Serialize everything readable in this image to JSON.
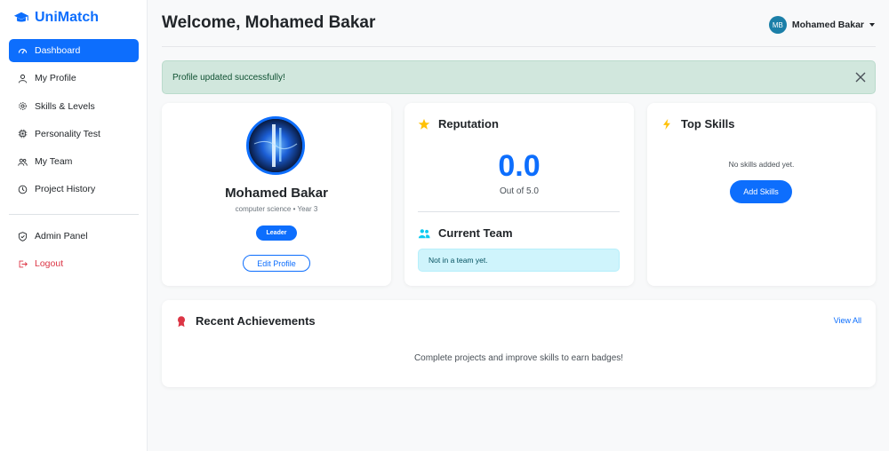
{
  "brand": {
    "name": "UniMatch",
    "icon": "graduation-cap-icon"
  },
  "sidebar": {
    "items": [
      {
        "label": "Dashboard",
        "icon": "speedometer-icon",
        "active": true
      },
      {
        "label": "My Profile",
        "icon": "person-icon"
      },
      {
        "label": "Skills & Levels",
        "icon": "gear-icon"
      },
      {
        "label": "Personality Test",
        "icon": "cpu-icon"
      },
      {
        "label": "My Team",
        "icon": "people-icon"
      },
      {
        "label": "Project History",
        "icon": "clock-icon"
      }
    ],
    "secondary": [
      {
        "label": "Admin Panel",
        "icon": "shield-icon"
      },
      {
        "label": "Logout",
        "icon": "logout-icon"
      }
    ]
  },
  "header": {
    "title": "Welcome, Mohamed Bakar",
    "user_initials": "MB",
    "user_name": "Mohamed Bakar"
  },
  "alert": {
    "message": "Profile updated successfully!"
  },
  "profile": {
    "name": "Mohamed Bakar",
    "subtitle": "computer science • Year 3",
    "role_badge": "Leader",
    "edit_label": "Edit Profile"
  },
  "reputation": {
    "title": "Reputation",
    "score": "0.0",
    "out_of": "Out of 5.0"
  },
  "team": {
    "title": "Current Team",
    "status": "Not in a team yet."
  },
  "skills": {
    "title": "Top Skills",
    "empty": "No skills added yet.",
    "add_label": "Add Skills"
  },
  "achievements": {
    "title": "Recent Achievements",
    "view_all": "View All",
    "empty": "Complete projects and improve skills to earn badges!"
  },
  "colors": {
    "primary": "#0d6efd",
    "success_bg": "#d1e7dd",
    "info_bg": "#cff4fc",
    "danger": "#dc3545",
    "star": "#ffc107",
    "award": "#dc3545"
  }
}
